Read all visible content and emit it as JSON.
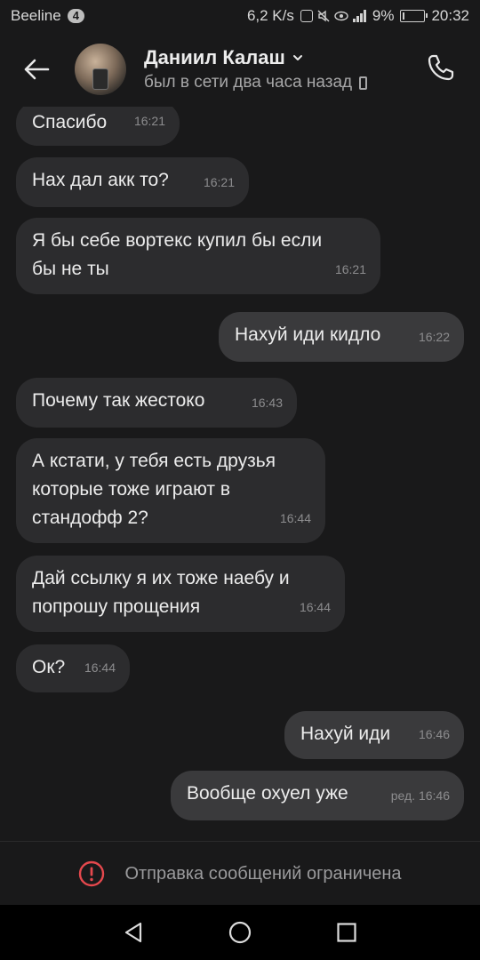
{
  "status_bar": {
    "carrier": "Beeline",
    "badge": "4",
    "speed": "6,2 K/s",
    "battery": "9%",
    "battery_level": 0.09,
    "time": "20:32"
  },
  "header": {
    "name": "Даниил Калаш",
    "status": "был в сети два часа назад",
    "icons": {
      "back": "back-arrow-icon",
      "call": "phone-icon",
      "dropdown": "chevron-down-icon",
      "device": "mobile-device-icon"
    }
  },
  "messages": [
    {
      "text": "Спасибо",
      "time": "16:21",
      "direction": "in"
    },
    {
      "text": "Нах дал акк то?",
      "time": "16:21",
      "direction": "in"
    },
    {
      "text": "Я бы себе вортекс купил бы если\nбы не ты",
      "time": "16:21",
      "direction": "in"
    },
    {
      "text": "Нахуй иди кидло",
      "time": "16:22",
      "direction": "out"
    },
    {
      "text": "Почему так жестоко",
      "time": "16:43",
      "direction": "in"
    },
    {
      "text": "А кстати, у тебя есть друзья\nкоторые тоже играют в\nстандофф 2?",
      "time": "16:44",
      "direction": "in"
    },
    {
      "text": "Дай ссылку я их тоже наебу и\nпопрошу прощения",
      "time": "16:44",
      "direction": "in"
    },
    {
      "text": "Ок?",
      "time": "16:44",
      "direction": "in"
    },
    {
      "text": "Нахуй иди",
      "time": "16:46",
      "direction": "out"
    },
    {
      "text": "Вообще охуел уже",
      "time": "ред. 16:46",
      "direction": "out"
    }
  ],
  "restriction": {
    "text": "Отправка сообщений ограничена",
    "icon": "warning-icon",
    "color": "#e5484d"
  },
  "navbar": {
    "icons": [
      "back-triangle-icon",
      "home-circle-icon",
      "recents-square-icon"
    ]
  }
}
